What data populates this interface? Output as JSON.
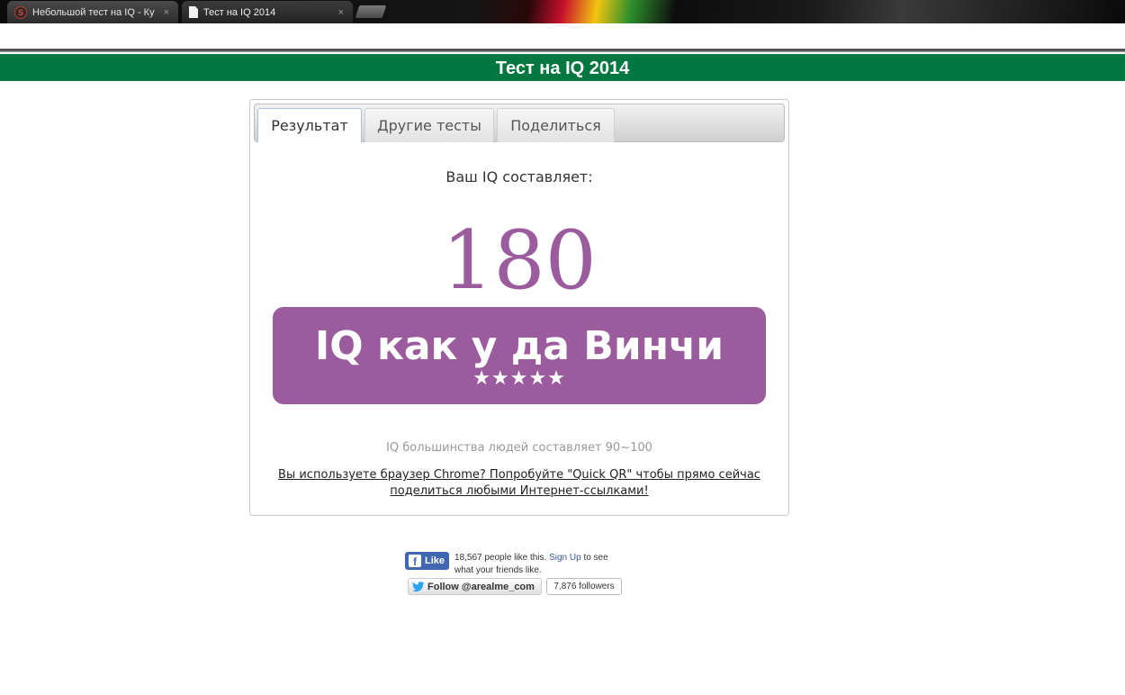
{
  "browser": {
    "tabs": [
      {
        "label": "Небольшой тест на IQ - Ку",
        "icon": "s-favicon",
        "close": "×"
      },
      {
        "label": "Тест на IQ 2014",
        "icon": "document-icon",
        "close": "×"
      }
    ]
  },
  "header": {
    "title": "Тест на IQ 2014",
    "color": "#02773f"
  },
  "tabs": [
    {
      "label": "Результат",
      "active": true
    },
    {
      "label": "Другие тесты",
      "active": false
    },
    {
      "label": "Поделиться",
      "active": false
    }
  ],
  "result": {
    "label": "Ваш IQ составляет:",
    "score": "180",
    "badge_title": "IQ как у да Винчи",
    "stars": "★★★★★",
    "accent": "#9b5c9e",
    "average_note": "IQ большинства людей составляет 90~100",
    "promo_line1": "Вы используете браузер Chrome? Попробуйте \"Quick QR\" чтобы прямо сейчас",
    "promo_line2": "поделиться любыми Интернет-ссылками!"
  },
  "social": {
    "fb_like_label": "Like",
    "fb_count_text": "18,567 people like this.",
    "fb_signup": "Sign Up",
    "fb_tail": "to see",
    "fb_line2": "what your friends like.",
    "twitter_follow": "Follow @arealme_com",
    "twitter_followers": "7,876 followers"
  }
}
